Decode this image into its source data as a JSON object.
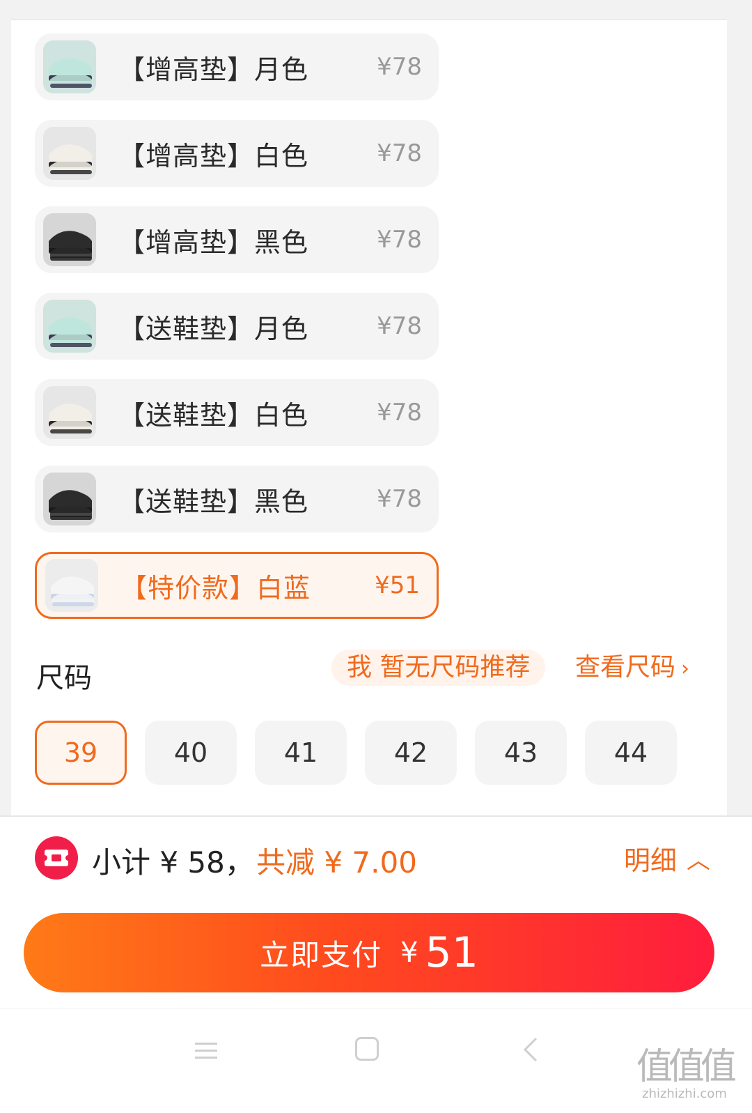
{
  "variants": [
    {
      "name": "【增高垫】月色",
      "price": "¥78",
      "selected": false,
      "thumb": "mint"
    },
    {
      "name": "【增高垫】白色",
      "price": "¥78",
      "selected": false,
      "thumb": "white"
    },
    {
      "name": "【增高垫】黑色",
      "price": "¥78",
      "selected": false,
      "thumb": "black"
    },
    {
      "name": "【送鞋垫】月色",
      "price": "¥78",
      "selected": false,
      "thumb": "mint"
    },
    {
      "name": "【送鞋垫】白色",
      "price": "¥78",
      "selected": false,
      "thumb": "white"
    },
    {
      "name": "【送鞋垫】黑色",
      "price": "¥78",
      "selected": false,
      "thumb": "black"
    },
    {
      "name": "【特价款】白蓝",
      "price": "¥51",
      "selected": true,
      "thumb": "whiteblue"
    }
  ],
  "size": {
    "label": "尺码",
    "recommend": "我 暂无尺码推荐",
    "chart_link": "查看尺码",
    "options": [
      "39",
      "40",
      "41",
      "42",
      "43",
      "44"
    ],
    "selected": "39"
  },
  "summary": {
    "subtotal": "小计 ¥ 58，",
    "discount": "共减 ¥ 7.00",
    "details": "明细"
  },
  "pay": {
    "label": "立即支付",
    "currency": "¥",
    "amount": "51"
  },
  "watermark": {
    "glyph": "值值值",
    "text": "zhizhizhi.com"
  },
  "colors": {
    "accent": "#f06a1d",
    "pay_gradient_start": "#ff7a17",
    "pay_gradient_end": "#ff1d3d",
    "coupon_red": "#f21e4a"
  }
}
